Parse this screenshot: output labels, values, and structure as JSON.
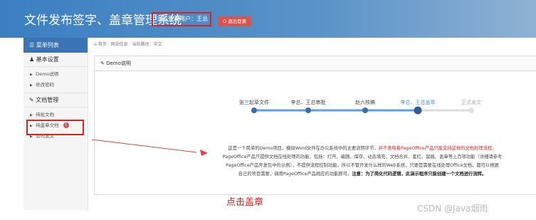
{
  "header": {
    "title": "文件发布签字、盖章管理系统",
    "current_user": "当前登录用户：王总",
    "logout_label": "退出登录"
  },
  "sidebar": {
    "title": "菜单列表",
    "groups": [
      {
        "label": "基本设置",
        "items": [
          {
            "label": "Demo说明"
          },
          {
            "label": "修改密码"
          }
        ]
      },
      {
        "label": "文档管理",
        "items": [
          {
            "label": "待批文档"
          },
          {
            "label": "待盖章文档",
            "badge": "1"
          },
          {
            "label": "公司发文"
          }
        ]
      }
    ]
  },
  "breadcrumb": {
    "home": "首页",
    "site": "网站信息",
    "current": "当前路径：中文"
  },
  "panel": {
    "title": "Demo说明",
    "steps": [
      {
        "label": "张三起草文件",
        "state": "done"
      },
      {
        "label": "李总、王总审批",
        "state": "done"
      },
      {
        "label": "赵六核稿",
        "state": "done"
      },
      {
        "label": "李总、王总盖章",
        "state": "active"
      },
      {
        "label": "正式发文",
        "state": "pending"
      }
    ],
    "desc_lines": [
      {
        "text": "这是一个简单的Demo项目，模拟Word文件在办公系统中的主要流转环节，",
        "warn": "并不意味着PageOffice产品只能支持这样的文档处理流程。"
      },
      {
        "text": "PageOffice产品只提供文档在线处理的功能，包括：打开、编辑、保存、动态填充、文档合并、套红、留痕、盖章等上百项功能（详细请参考"
      },
      {
        "text": "PageOffice产品开发包中的示例），不提供流程控制功能，所以不管开发什么样的Web系统，只要是需要在线处理Office文档，都可以根据"
      },
      {
        "text": "自己的项目需要，调用PageOffice产品相应的功能即可。",
        "bold": "注意：为了简化代码逻辑，此演示程序只能创建一个文档进行流转。"
      }
    ]
  },
  "annotation": "点击盖章",
  "watermark": "CSDN @Java烟雨",
  "colors": {
    "accent": "#4a8dd4",
    "header_start": "#3a7fc2",
    "highlight_red": "#dd2222",
    "logout_bg": "#d9534f"
  }
}
